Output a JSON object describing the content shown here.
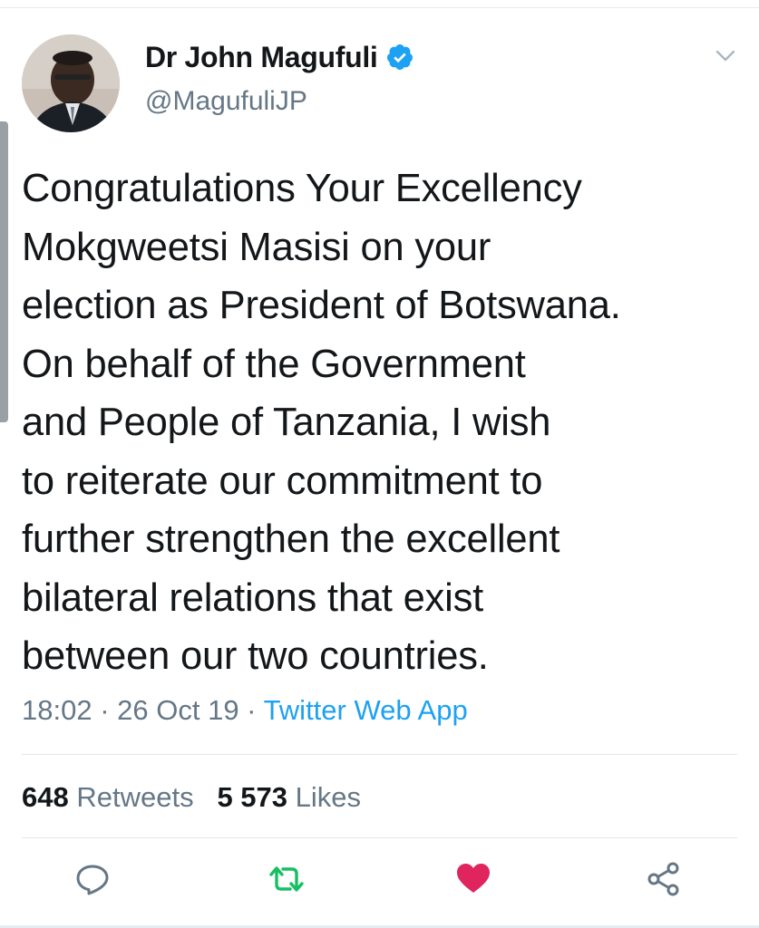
{
  "tweet": {
    "author_name": "Dr John Magufuli",
    "handle": "@MagufuliJP",
    "text_lines": [
      "Congratulations Your Excellency",
      "Mokgweetsi Masisi on your",
      "election as President of Botswana.",
      "On behalf of the Government",
      "and People of Tanzania, I wish",
      "to reiterate our commitment to",
      "further strengthen the excellent",
      "bilateral relations that exist",
      "between our two countries."
    ],
    "time": "18:02",
    "date": "26 Oct 19",
    "separator": " · ",
    "source": "Twitter Web App"
  },
  "stats": {
    "retweets_count": "648",
    "retweets_label": "Retweets",
    "likes_count": "5 573",
    "likes_label": "Likes"
  },
  "icons": {
    "verified": "verified-badge-icon",
    "menu": "chevron-down-icon",
    "reply": "reply-icon",
    "retweet": "retweet-icon",
    "like": "heart-icon",
    "share": "share-icon"
  },
  "colors": {
    "verified_blue": "#1da1f2",
    "retweet_green": "#17bf63",
    "like_red": "#e0245e",
    "secondary_text": "#657786",
    "source_link": "#1da1f2"
  }
}
